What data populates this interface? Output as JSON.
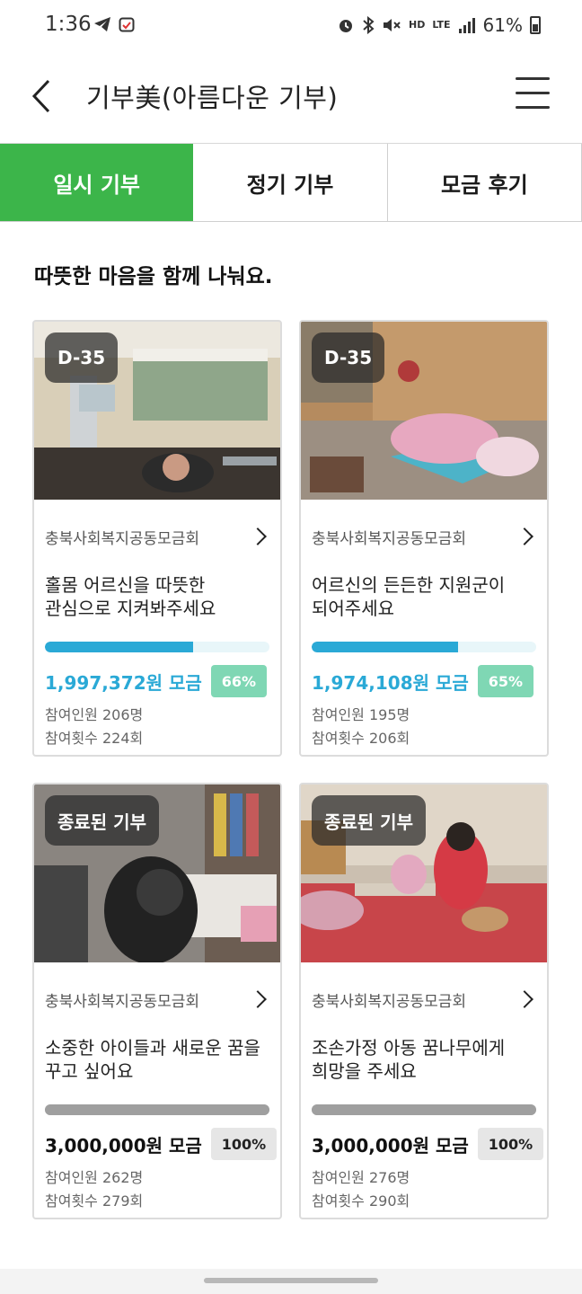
{
  "status": {
    "time": "1:36",
    "network": "LTE",
    "hd": "HD",
    "battery": "61%"
  },
  "header": {
    "title": "기부美(아름다운 기부)"
  },
  "tabs": [
    {
      "label": "일시 기부",
      "active": true
    },
    {
      "label": "정기 기부",
      "active": false
    },
    {
      "label": "모금 후기",
      "active": false
    }
  ],
  "section_title": "따뜻한 마음을 함께 나눠요.",
  "colors": {
    "accent_green": "#3cb54a",
    "progress_blue": "#2aa9d6",
    "pct_green": "#7fd7b4"
  },
  "cards": [
    {
      "badge": "D-35",
      "org": "충북사회복지공동모금회",
      "title_line1": "홀몸 어르신을 따뜻한",
      "title_line2": "관심으로 지켜봐주세요",
      "progress": 0.66,
      "amount": "1,997,372원 모금",
      "percent": "66%",
      "participants": "참여인원 206명",
      "count": "참여횟수 224회"
    },
    {
      "badge": "D-35",
      "org": "충북사회복지공동모금회",
      "title_line1": "어르신의 든든한 지원군이",
      "title_line2": "되어주세요",
      "progress": 0.65,
      "amount": "1,974,108원 모금",
      "percent": "65%",
      "participants": "참여인원 195명",
      "count": "참여횟수 206회"
    },
    {
      "badge": "종료된 기부",
      "org": "충북사회복지공동모금회",
      "title_line1": "소중한 아이들과 새로운 꿈을",
      "title_line2": "꾸고 싶어요",
      "progress": 1.0,
      "amount": "3,000,000원 모금",
      "percent": "100%",
      "participants": "참여인원 262명",
      "count": "참여횟수 279회"
    },
    {
      "badge": "종료된 기부",
      "org": "충북사회복지공동모금회",
      "title_line1": "조손가정 아동 꿈나무에게",
      "title_line2": "희망을 주세요",
      "progress": 1.0,
      "amount": "3,000,000원 모금",
      "percent": "100%",
      "participants": "참여인원 276명",
      "count": "참여횟수 290회"
    }
  ]
}
